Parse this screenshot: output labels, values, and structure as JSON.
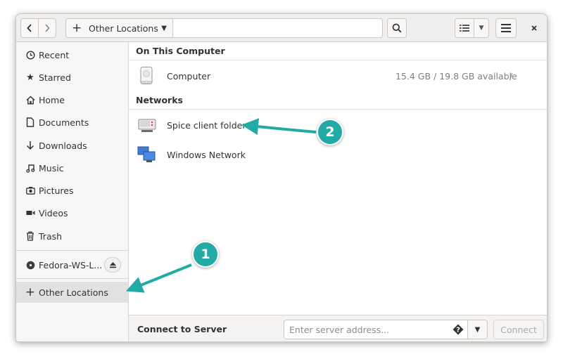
{
  "window": {
    "title": "Other Locations"
  },
  "toolbar": {
    "location_label": "Other Locations",
    "back_icon": "chevron-left-icon",
    "forward_icon": "chevron-right-icon",
    "search_icon": "search-icon",
    "view_icon": "list-view-icon",
    "menu_icon": "hamburger-menu-icon",
    "close_icon": "close-icon"
  },
  "sidebar": {
    "items": [
      {
        "label": "Recent",
        "icon": "clock-icon"
      },
      {
        "label": "Starred",
        "icon": "star-icon"
      },
      {
        "label": "Home",
        "icon": "home-icon"
      },
      {
        "label": "Documents",
        "icon": "document-icon"
      },
      {
        "label": "Downloads",
        "icon": "download-icon"
      },
      {
        "label": "Music",
        "icon": "music-icon"
      },
      {
        "label": "Pictures",
        "icon": "camera-icon"
      },
      {
        "label": "Videos",
        "icon": "video-icon"
      },
      {
        "label": "Trash",
        "icon": "trash-icon"
      }
    ],
    "device": {
      "label": "Fedora-WS-L...",
      "icon": "disc-icon",
      "eject_icon": "eject-icon"
    },
    "other_locations": {
      "label": "Other Locations",
      "icon": "plus-icon",
      "active": true
    }
  },
  "main": {
    "on_this_computer": {
      "heading": "On This Computer",
      "items": [
        {
          "label": "Computer",
          "space": "15.4 GB / 19.8 GB available",
          "path": "/",
          "icon": "drive-harddisk-icon"
        }
      ]
    },
    "networks": {
      "heading": "Networks",
      "items": [
        {
          "label": "Spice client folder",
          "icon": "network-server-icon"
        },
        {
          "label": "Windows Network",
          "icon": "network-workgroup-icon"
        }
      ]
    }
  },
  "bottom": {
    "connect_label": "Connect to Server",
    "server_placeholder": "Enter server address...",
    "connect_button": "Connect"
  },
  "callouts": [
    "1",
    "2"
  ],
  "colors": {
    "callout": "#22aaa6",
    "active_row": "#e3e1df"
  }
}
